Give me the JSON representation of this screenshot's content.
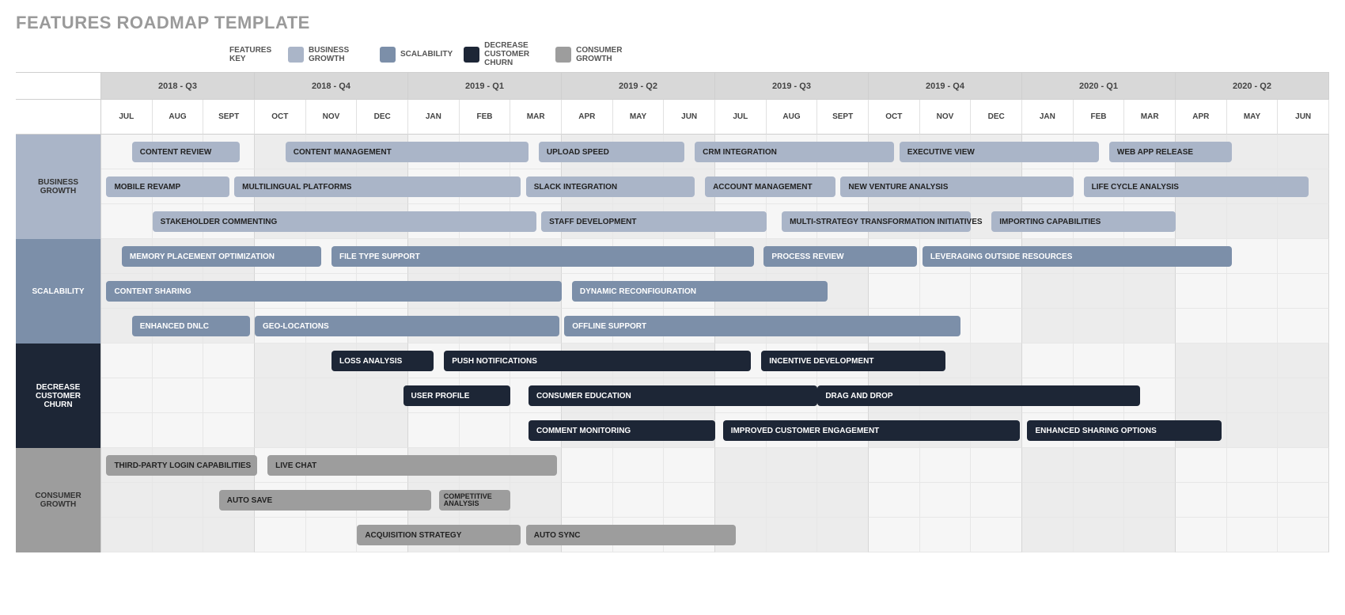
{
  "title": "FEATURES ROADMAP TEMPLATE",
  "legend": {
    "key": "FEATURES KEY",
    "items": [
      {
        "label": "BUSINESS GROWTH",
        "theme": "bg"
      },
      {
        "label": "SCALABILITY",
        "theme": "sc"
      },
      {
        "label": "DECREASE CUSTOMER CHURN",
        "theme": "dc"
      },
      {
        "label": "CONSUMER GROWTH",
        "theme": "cg"
      }
    ]
  },
  "quarters": [
    "2018 - Q3",
    "2018 - Q4",
    "2019 - Q1",
    "2019 - Q2",
    "2019 - Q3",
    "2019 - Q4",
    "2020 - Q1",
    "2020 - Q2"
  ],
  "months": [
    "JUL",
    "AUG",
    "SEPT",
    "OCT",
    "NOV",
    "DEC",
    "JAN",
    "FEB",
    "MAR",
    "APR",
    "MAY",
    "JUN",
    "JUL",
    "AUG",
    "SEPT",
    "OCT",
    "NOV",
    "DEC",
    "JAN",
    "FEB",
    "MAR",
    "APR",
    "MAY",
    "JUN"
  ],
  "lanes": [
    {
      "name": "BUSINESS GROWTH",
      "theme": "bg"
    },
    {
      "name": "SCALABILITY",
      "theme": "sc"
    },
    {
      "name": "DECREASE CUSTOMER CHURN",
      "theme": "dc"
    },
    {
      "name": "CONSUMER GROWTH",
      "theme": "cg"
    }
  ],
  "chart_data": {
    "type": "gantt",
    "time_axis_months": [
      "2018-07",
      "2018-08",
      "2018-09",
      "2018-10",
      "2018-11",
      "2018-12",
      "2019-01",
      "2019-02",
      "2019-03",
      "2019-04",
      "2019-05",
      "2019-06",
      "2019-07",
      "2019-08",
      "2019-09",
      "2019-10",
      "2019-11",
      "2019-12",
      "2020-01",
      "2020-02",
      "2020-03",
      "2020-04",
      "2020-05",
      "2020-06"
    ],
    "lanes": [
      {
        "name": "BUSINESS GROWTH",
        "rows": 3,
        "theme": "bg",
        "bars": [
          {
            "label": "CONTENT REVIEW",
            "row": 0,
            "start": 0.6,
            "end": 2.7
          },
          {
            "label": "CONTENT MANAGEMENT",
            "row": 0,
            "start": 3.6,
            "end": 8.35
          },
          {
            "label": "UPLOAD SPEED",
            "row": 0,
            "start": 8.55,
            "end": 11.4
          },
          {
            "label": "CRM INTEGRATION",
            "row": 0,
            "start": 11.6,
            "end": 15.5
          },
          {
            "label": "EXECUTIVE VIEW",
            "row": 0,
            "start": 15.6,
            "end": 19.5
          },
          {
            "label": "WEB APP RELEASE",
            "row": 0,
            "start": 19.7,
            "end": 22.1
          },
          {
            "label": "MOBILE REVAMP",
            "row": 1,
            "start": 0.1,
            "end": 2.5
          },
          {
            "label": "MULTILINGUAL PLATFORMS",
            "row": 1,
            "start": 2.6,
            "end": 8.2
          },
          {
            "label": "SLACK INTEGRATION",
            "row": 1,
            "start": 8.3,
            "end": 11.6
          },
          {
            "label": "ACCOUNT MANAGEMENT",
            "row": 1,
            "start": 11.8,
            "end": 14.35
          },
          {
            "label": "NEW VENTURE ANALYSIS",
            "row": 1,
            "start": 14.45,
            "end": 19.0
          },
          {
            "label": "LIFE CYCLE ANALYSIS",
            "row": 1,
            "start": 19.2,
            "end": 23.6
          },
          {
            "label": "STAKEHOLDER COMMENTING",
            "row": 2,
            "start": 1.0,
            "end": 8.5
          },
          {
            "label": "STAFF DEVELOPMENT",
            "row": 2,
            "start": 8.6,
            "end": 13.0
          },
          {
            "label": "MULTI-STRATEGY TRANSFORMATION INITIATIVES",
            "row": 2,
            "start": 13.3,
            "end": 17.0
          },
          {
            "label": "IMPORTING CAPABILITIES",
            "row": 2,
            "start": 17.4,
            "end": 21.0
          }
        ]
      },
      {
        "name": "SCALABILITY",
        "rows": 3,
        "theme": "sc",
        "bars": [
          {
            "label": "MEMORY PLACEMENT OPTIMIZATION",
            "row": 0,
            "start": 0.4,
            "end": 4.3
          },
          {
            "label": "FILE TYPE SUPPORT",
            "row": 0,
            "start": 4.5,
            "end": 12.75
          },
          {
            "label": "PROCESS REVIEW",
            "row": 0,
            "start": 12.95,
            "end": 15.95
          },
          {
            "label": "LEVERAGING OUTSIDE RESOURCES",
            "row": 0,
            "start": 16.05,
            "end": 22.1
          },
          {
            "label": "CONTENT SHARING",
            "row": 1,
            "start": 0.1,
            "end": 9.0
          },
          {
            "label": "DYNAMIC RECONFIGURATION",
            "row": 1,
            "start": 9.2,
            "end": 14.2
          },
          {
            "label": "ENHANCED DNLC",
            "row": 2,
            "start": 0.6,
            "end": 2.9
          },
          {
            "label": "GEO-LOCATIONS",
            "row": 2,
            "start": 3.0,
            "end": 8.95
          },
          {
            "label": "OFFLINE SUPPORT",
            "row": 2,
            "start": 9.05,
            "end": 16.8
          }
        ]
      },
      {
        "name": "DECREASE CUSTOMER CHURN",
        "rows": 3,
        "theme": "dc",
        "bars": [
          {
            "label": "LOSS ANALYSIS",
            "row": 0,
            "start": 4.5,
            "end": 6.5
          },
          {
            "label": "PUSH NOTIFICATIONS",
            "row": 0,
            "start": 6.7,
            "end": 12.7
          },
          {
            "label": "INCENTIVE DEVELOPMENT",
            "row": 0,
            "start": 12.9,
            "end": 16.5
          },
          {
            "label": "USER PROFILE",
            "row": 1,
            "start": 5.9,
            "end": 8.0
          },
          {
            "label": "CONSUMER EDUCATION",
            "row": 1,
            "start": 8.35,
            "end": 14.0
          },
          {
            "label": "DRAG AND DROP",
            "row": 1,
            "start": 14.0,
            "end": 20.3
          },
          {
            "label": "COMMENT MONITORING",
            "row": 2,
            "start": 8.35,
            "end": 12.0
          },
          {
            "label": "IMPROVED CUSTOMER ENGAGEMENT",
            "row": 2,
            "start": 12.15,
            "end": 17.95
          },
          {
            "label": "ENHANCED SHARING OPTIONS",
            "row": 2,
            "start": 18.1,
            "end": 21.9
          }
        ]
      },
      {
        "name": "CONSUMER GROWTH",
        "rows": 3,
        "theme": "cg",
        "bars": [
          {
            "label": "THIRD-PARTY LOGIN CAPABILITIES",
            "row": 0,
            "start": 0.1,
            "end": 3.05
          },
          {
            "label": "LIVE CHAT",
            "row": 0,
            "start": 3.25,
            "end": 8.9
          },
          {
            "label": "AUTO SAVE",
            "row": 1,
            "start": 2.3,
            "end": 6.45
          },
          {
            "label": "COMPETITIVE ANALYSIS",
            "row": 1,
            "start": 6.6,
            "end": 8.0,
            "small": true
          },
          {
            "label": "ACQUISITION STRATEGY",
            "row": 2,
            "start": 5.0,
            "end": 8.2
          },
          {
            "label": "AUTO SYNC",
            "row": 2,
            "start": 8.3,
            "end": 12.4
          }
        ]
      }
    ]
  }
}
